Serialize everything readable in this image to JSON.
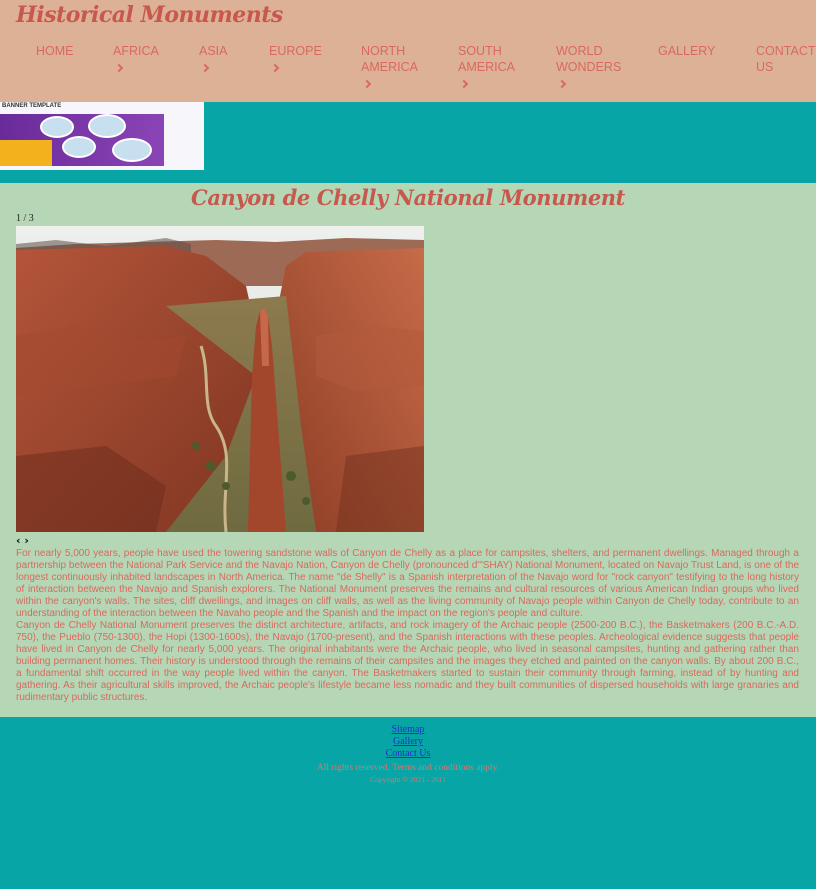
{
  "site": {
    "logo": "Historical Monuments"
  },
  "nav": {
    "items": [
      {
        "label": "HOME"
      },
      {
        "label": "AFRICA"
      },
      {
        "label": "ASIA"
      },
      {
        "label": "EUROPE"
      },
      {
        "label": "NORTH AMERICA"
      },
      {
        "label": "SOUTH AMERICA"
      },
      {
        "label": "WORLD WONDERS"
      },
      {
        "label": "GALLERY"
      },
      {
        "label": "CONTACT US"
      }
    ]
  },
  "banner": {
    "label": "BANNER TEMPLATE"
  },
  "main": {
    "title": "Canyon de Chelly National Monument",
    "slide_counter": "1 / 3",
    "prev": "‹",
    "next": "›",
    "paragraphs": [
      "For nearly 5,000 years, people have used the towering sandstone walls of Canyon de Chelly as a place for campsites, shelters, and permanent dwellings. Managed through a partnership between the National Park Service and the Navajo Nation, Canyon de Chelly (pronounced d'\"SHAY) National Monument, located on Navajo Trust Land, is one of the longest continuously inhabited landscapes in North America. The name \"de Shelly\" is a Spanish interpretation of the Navajo word for \"rock canyon\" testifying to the long history of interaction between the Navajo and Spanish explorers. The National Monument preserves the remains and cultural resources of various American Indian groups who lived within the canyon's walls. The sites, cliff dwellings, and images on cliff walls, as well as the living community of Navajo people within Canyon de Chelly today, contribute to an understanding of the interaction between the Navaho people and the Spanish and the impact on the region's people and culture.",
      "Canyon de Chelly National Monument preserves the distinct architecture, artifacts, and rock imagery of the Archaic people (2500-200 B.C.), the Basketmakers (200 B.C.-A.D. 750), the Pueblo (750-1300), the Hopi (1300-1600s), the Navajo (1700-present), and the Spanish interactions with these peoples. Archeological evidence suggests that people have lived in Canyon de Chelly for nearly 5,000 years. The original inhabitants were the Archaic people, who lived in seasonal campsites, hunting and gathering rather than building permanent homes. Their history is understood through the remains of their campsites and the images they etched and painted on the canyon walls. By about 200 B.C., a fundamental shift occurred in the way people lived within the canyon. The Basketmakers started to sustain their community through farming, instead of by hunting and gathering. As their agricultural skills improved, the Archaic people's lifestyle became less nomadic and they built communities of dispersed households with large granaries and rudimentary public structures."
    ]
  },
  "footer": {
    "links": [
      "Sitemap",
      "Gallery",
      "Contact Us"
    ],
    "rights": "All rights reserved. Terms and conditions apply.",
    "copyright": "Copyright © 2021 - 2011"
  }
}
